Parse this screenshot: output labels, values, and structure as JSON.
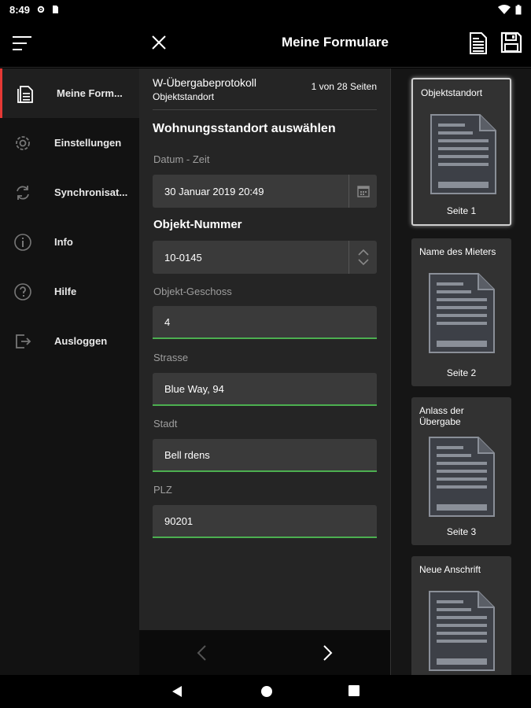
{
  "status": {
    "time": "8:49"
  },
  "appbar": {
    "title": "Meine Formulare"
  },
  "sidebar": {
    "items": [
      {
        "label": "Meine Form..."
      },
      {
        "label": "Einstellungen"
      },
      {
        "label": "Synchronisat..."
      },
      {
        "label": "Info"
      },
      {
        "label": "Hilfe"
      },
      {
        "label": "Ausloggen"
      }
    ]
  },
  "form": {
    "name": "W-Übergabeprotokoll",
    "subtitle": "Objektstandort",
    "pages": "1 von 28 Seiten",
    "section_title": "Wohnungsstandort auswählen",
    "fields": {
      "datum_label": "Datum - Zeit",
      "datum_value": "30 Januar 2019 20:49",
      "objekt_label": "Objekt-Nummer",
      "objekt_value": "10-0145",
      "geschoss_label": "Objekt-Geschoss",
      "geschoss_value": "4",
      "strasse_label": "Strasse",
      "strasse_value": "Blue Way, 94",
      "stadt_label": "Stadt",
      "stadt_value": "Bell rdens",
      "plz_label": "PLZ",
      "plz_value": "90201"
    }
  },
  "thumbnails": [
    {
      "name": "Objektstandort",
      "page": "Seite 1"
    },
    {
      "name": "Name des Mieters",
      "page": "Seite 2"
    },
    {
      "name": "Anlass der Übergabe",
      "page": "Seite 3"
    },
    {
      "name": "Neue Anschrift",
      "page": ""
    }
  ],
  "colors": {
    "accent_active": "#e53935",
    "field_underline": "#4caf50"
  }
}
